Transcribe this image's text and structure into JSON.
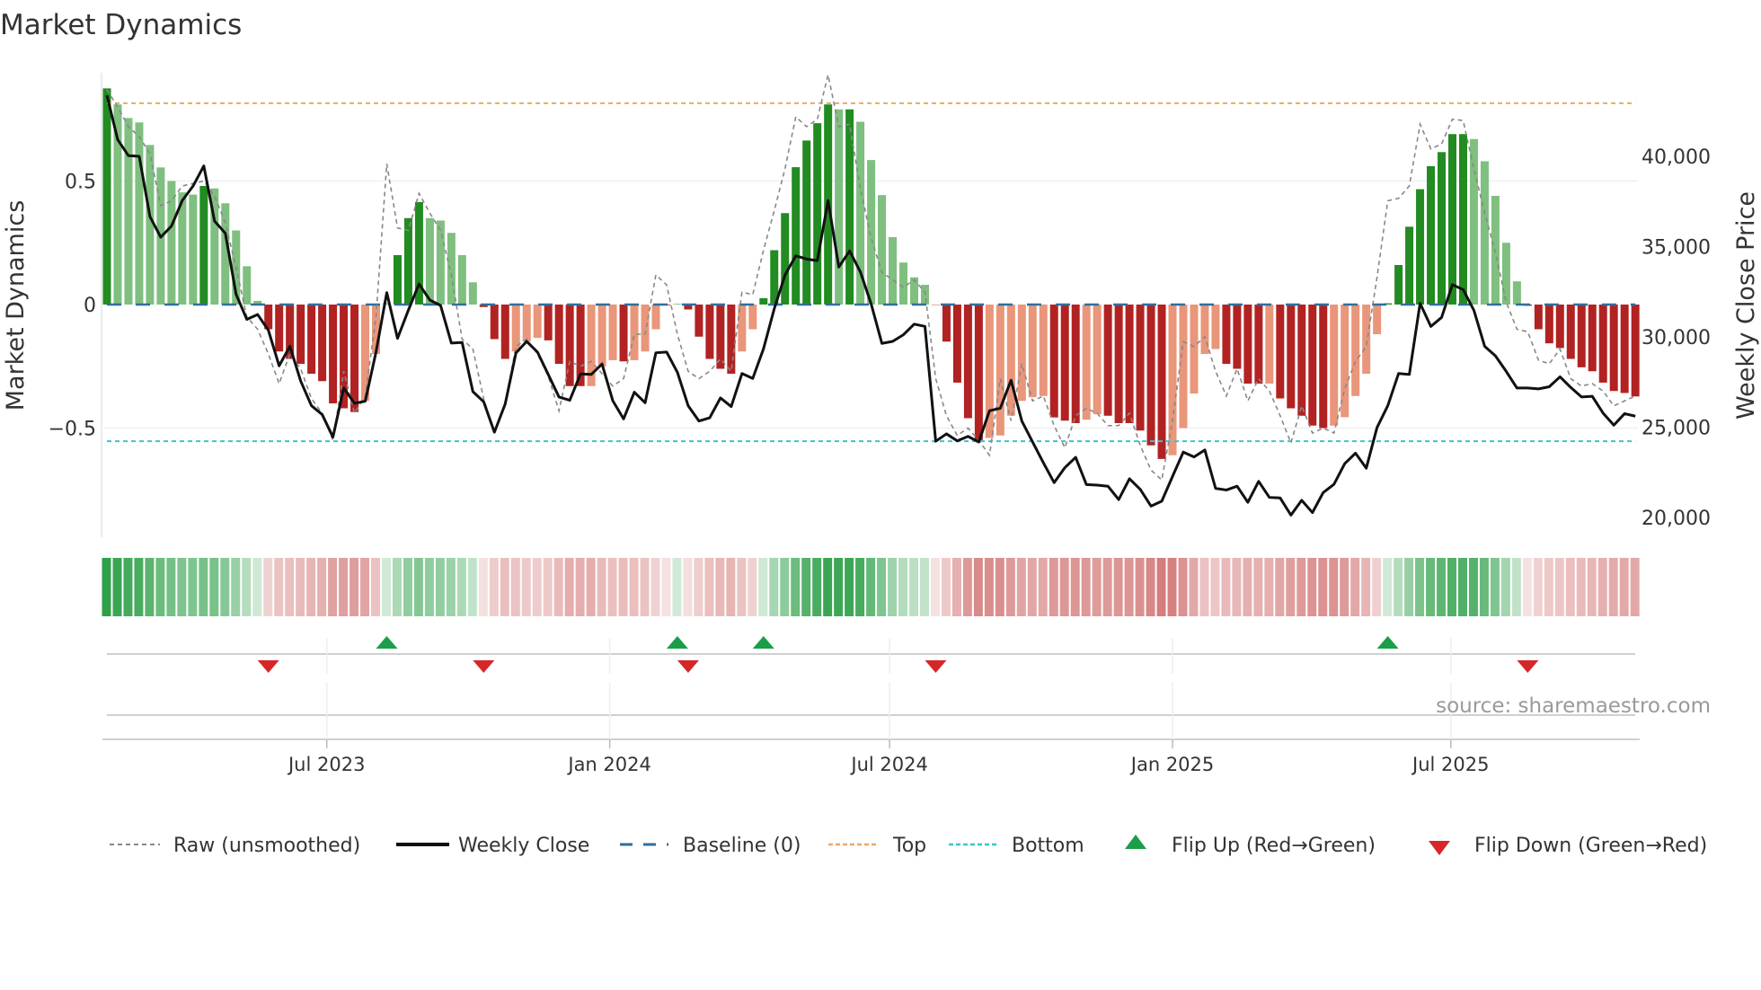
{
  "chart_data": {
    "type": "bar",
    "title": "Market Dynamics",
    "ylabel": "Market Dynamics",
    "y2label": "Weekly Close Price",
    "source": "source: sharemaestro.com",
    "start_date": "2023-02-08",
    "interval": "weekly",
    "ylim": [
      -0.95,
      0.95
    ],
    "y2lim": [
      17900,
      44650
    ],
    "yticks": [
      {
        "v": 0.5,
        "label": "0.5"
      },
      {
        "v": 0,
        "label": "0"
      },
      {
        "v": -0.5,
        "label": "−0.5"
      }
    ],
    "y2ticks": [
      {
        "v": 40000,
        "label": "40,000"
      },
      {
        "v": 35000,
        "label": "35,000"
      },
      {
        "v": 30000,
        "label": "30,000"
      },
      {
        "v": 25000,
        "label": "25,000"
      },
      {
        "v": 20000,
        "label": "20,000"
      }
    ],
    "xticks": [
      {
        "date": "2023-07-01",
        "label": "Jul 2023"
      },
      {
        "date": "2024-01-01",
        "label": "Jan 2024"
      },
      {
        "date": "2024-07-01",
        "label": "Jul 2024"
      },
      {
        "date": "2025-01-01",
        "label": "Jan 2025"
      },
      {
        "date": "2025-07-01",
        "label": "Jul 2025"
      }
    ],
    "levels": {
      "baseline": 0,
      "top": 0.815,
      "bottom": -0.553
    },
    "colors": {
      "strong_up": "#228b22",
      "weak_up": "#7fbf7f",
      "strong_down": "#b22222",
      "weak_down": "#e9967a",
      "close": "#111111",
      "raw": "#888888",
      "baseline": "#2f6f9f",
      "top": "#e8a96a",
      "bottom": "#3cc4d0",
      "flip_up": "#1a9e4a",
      "flip_down": "#d62728"
    },
    "momentum": [
      0.875,
      0.81,
      0.755,
      0.737,
      0.646,
      0.555,
      0.5,
      0.454,
      0.445,
      0.48,
      0.47,
      0.41,
      0.3,
      0.155,
      0.015,
      -0.1,
      -0.19,
      -0.22,
      -0.24,
      -0.28,
      -0.31,
      -0.4,
      -0.42,
      -0.435,
      -0.39,
      -0.2,
      0.005,
      0.2,
      0.35,
      0.415,
      0.35,
      0.34,
      0.29,
      0.2,
      0.09,
      -0.01,
      -0.14,
      -0.22,
      -0.19,
      -0.15,
      -0.135,
      -0.145,
      -0.24,
      -0.33,
      -0.33,
      -0.33,
      -0.25,
      -0.225,
      -0.23,
      -0.225,
      -0.19,
      -0.1,
      -0.003,
      0.003,
      -0.02,
      -0.13,
      -0.22,
      -0.26,
      -0.28,
      -0.19,
      -0.1,
      0.026,
      0.22,
      0.37,
      0.556,
      0.664,
      0.734,
      0.81,
      0.79,
      0.79,
      0.74,
      0.585,
      0.443,
      0.273,
      0.17,
      0.11,
      0.08,
      -0.003,
      -0.15,
      -0.316,
      -0.46,
      -0.55,
      -0.54,
      -0.53,
      -0.45,
      -0.39,
      -0.375,
      -0.37,
      -0.457,
      -0.47,
      -0.48,
      -0.466,
      -0.444,
      -0.45,
      -0.48,
      -0.48,
      -0.51,
      -0.57,
      -0.625,
      -0.61,
      -0.5,
      -0.36,
      -0.2,
      -0.18,
      -0.24,
      -0.26,
      -0.32,
      -0.32,
      -0.32,
      -0.38,
      -0.42,
      -0.45,
      -0.49,
      -0.5,
      -0.49,
      -0.456,
      -0.37,
      -0.28,
      -0.12,
      0.005,
      0.16,
      0.315,
      0.467,
      0.56,
      0.617,
      0.69,
      0.69,
      0.67,
      0.58,
      0.44,
      0.25,
      0.094,
      -0.005,
      -0.1,
      -0.157,
      -0.176,
      -0.22,
      -0.254,
      -0.27,
      -0.316,
      -0.35,
      -0.358,
      -0.372
    ],
    "strong": [
      1,
      0,
      0,
      0,
      0,
      0,
      0,
      0,
      0,
      1,
      0,
      0,
      0,
      0,
      0,
      1,
      1,
      1,
      1,
      1,
      1,
      1,
      1,
      1,
      0,
      0,
      0,
      1,
      1,
      1,
      0,
      0,
      0,
      0,
      0,
      1,
      1,
      1,
      0,
      0,
      0,
      1,
      1,
      1,
      1,
      0,
      0,
      0,
      1,
      0,
      0,
      0,
      1,
      0,
      1,
      1,
      1,
      1,
      1,
      0,
      0,
      1,
      1,
      1,
      1,
      1,
      1,
      1,
      0,
      1,
      0,
      0,
      0,
      0,
      0,
      0,
      0,
      0,
      1,
      1,
      1,
      1,
      0,
      0,
      0,
      0,
      0,
      0,
      1,
      1,
      1,
      0,
      0,
      1,
      1,
      1,
      1,
      1,
      1,
      0,
      0,
      0,
      0,
      0,
      1,
      1,
      1,
      1,
      0,
      1,
      1,
      1,
      1,
      1,
      0,
      0,
      0,
      0,
      0,
      1,
      1,
      1,
      1,
      1,
      1,
      1,
      1,
      0,
      0,
      0,
      0,
      0,
      1,
      1,
      1,
      1,
      1,
      1,
      1,
      1,
      1,
      1,
      1
    ],
    "raw": [
      0.87,
      0.8,
      0.72,
      0.68,
      0.61,
      0.4,
      0.42,
      0.48,
      0.49,
      0.5,
      0.44,
      0.33,
      0.15,
      -0.05,
      -0.1,
      -0.2,
      -0.32,
      -0.2,
      -0.26,
      -0.38,
      -0.44,
      -0.55,
      -0.27,
      -0.44,
      -0.37,
      -0.05,
      0.57,
      0.31,
      0.3,
      0.45,
      0.37,
      0.3,
      0.12,
      -0.14,
      -0.18,
      -0.38,
      -0.52,
      -0.4,
      -0.17,
      -0.14,
      -0.2,
      -0.29,
      -0.43,
      -0.23,
      -0.25,
      -0.23,
      -0.28,
      -0.33,
      -0.3,
      -0.12,
      -0.12,
      0.12,
      0.08,
      -0.12,
      -0.27,
      -0.3,
      -0.27,
      -0.22,
      -0.27,
      0.05,
      0.04,
      0.22,
      0.38,
      0.55,
      0.76,
      0.72,
      0.75,
      0.93,
      0.72,
      0.73,
      0.47,
      0.27,
      0.13,
      0.1,
      0.07,
      0.1,
      0.05,
      -0.3,
      -0.45,
      -0.53,
      -0.5,
      -0.55,
      -0.61,
      -0.3,
      -0.47,
      -0.24,
      -0.39,
      -0.37,
      -0.49,
      -0.58,
      -0.45,
      -0.42,
      -0.44,
      -0.49,
      -0.49,
      -0.44,
      -0.57,
      -0.67,
      -0.71,
      -0.47,
      -0.15,
      -0.17,
      -0.13,
      -0.27,
      -0.37,
      -0.26,
      -0.39,
      -0.3,
      -0.35,
      -0.45,
      -0.56,
      -0.41,
      -0.52,
      -0.5,
      -0.52,
      -0.34,
      -0.23,
      -0.17,
      0.11,
      0.42,
      0.43,
      0.48,
      0.73,
      0.63,
      0.65,
      0.75,
      0.745,
      0.55,
      0.37,
      0.21,
      0.01,
      -0.1,
      -0.11,
      -0.225,
      -0.24,
      -0.18,
      -0.3,
      -0.33,
      -0.32,
      -0.35,
      -0.41,
      -0.39,
      -0.37
    ],
    "close": [
      43380,
      40925,
      40035,
      40000,
      36660,
      35520,
      36140,
      37550,
      38350,
      39470,
      36410,
      35740,
      32360,
      30970,
      31240,
      30370,
      28400,
      29480,
      27560,
      26190,
      25700,
      24450,
      27170,
      26320,
      26440,
      29160,
      32450,
      29920,
      31470,
      32930,
      32040,
      31740,
      29660,
      29690,
      26970,
      26410,
      24720,
      26280,
      29110,
      29750,
      29160,
      27920,
      26670,
      26490,
      27950,
      27920,
      28500,
      26460,
      25460,
      26940,
      26350,
      29120,
      29160,
      28040,
      26190,
      25340,
      25520,
      26620,
      26140,
      27970,
      27700,
      29340,
      31560,
      33430,
      34490,
      34310,
      34225,
      37550,
      33870,
      34760,
      33600,
      31830,
      29640,
      29750,
      30120,
      30705,
      30580,
      24220,
      24630,
      24240,
      24490,
      24180,
      25910,
      26050,
      27600,
      25340,
      24180,
      23030,
      21930,
      22760,
      23330,
      21820,
      21790,
      21730,
      20990,
      22140,
      21560,
      20630,
      20900,
      22270,
      23620,
      23350,
      23740,
      21610,
      21520,
      21730,
      20840,
      22000,
      21110,
      21080,
      20130,
      20950,
      20270,
      21380,
      21840,
      22980,
      23560,
      22730,
      24980,
      26190,
      27970,
      27920,
      31860,
      30580,
      31080,
      32890,
      32620,
      31470,
      29480,
      28950,
      28090,
      27170,
      27170,
      27120,
      27240,
      27790,
      27200,
      26670,
      26710,
      25780,
      25110,
      25750,
      25610
    ],
    "flips_up": [
      26,
      53,
      61,
      119
    ],
    "flips_down": [
      15,
      35,
      54,
      77,
      132
    ],
    "legend": {
      "raw": "Raw (unsmoothed)",
      "close": "Weekly Close",
      "baseline": "Baseline (0)",
      "top": "Top",
      "bottom": "Bottom",
      "flip_up": "Flip Up (Red→Green)",
      "flip_down": "Flip Down (Green→Red)"
    }
  }
}
